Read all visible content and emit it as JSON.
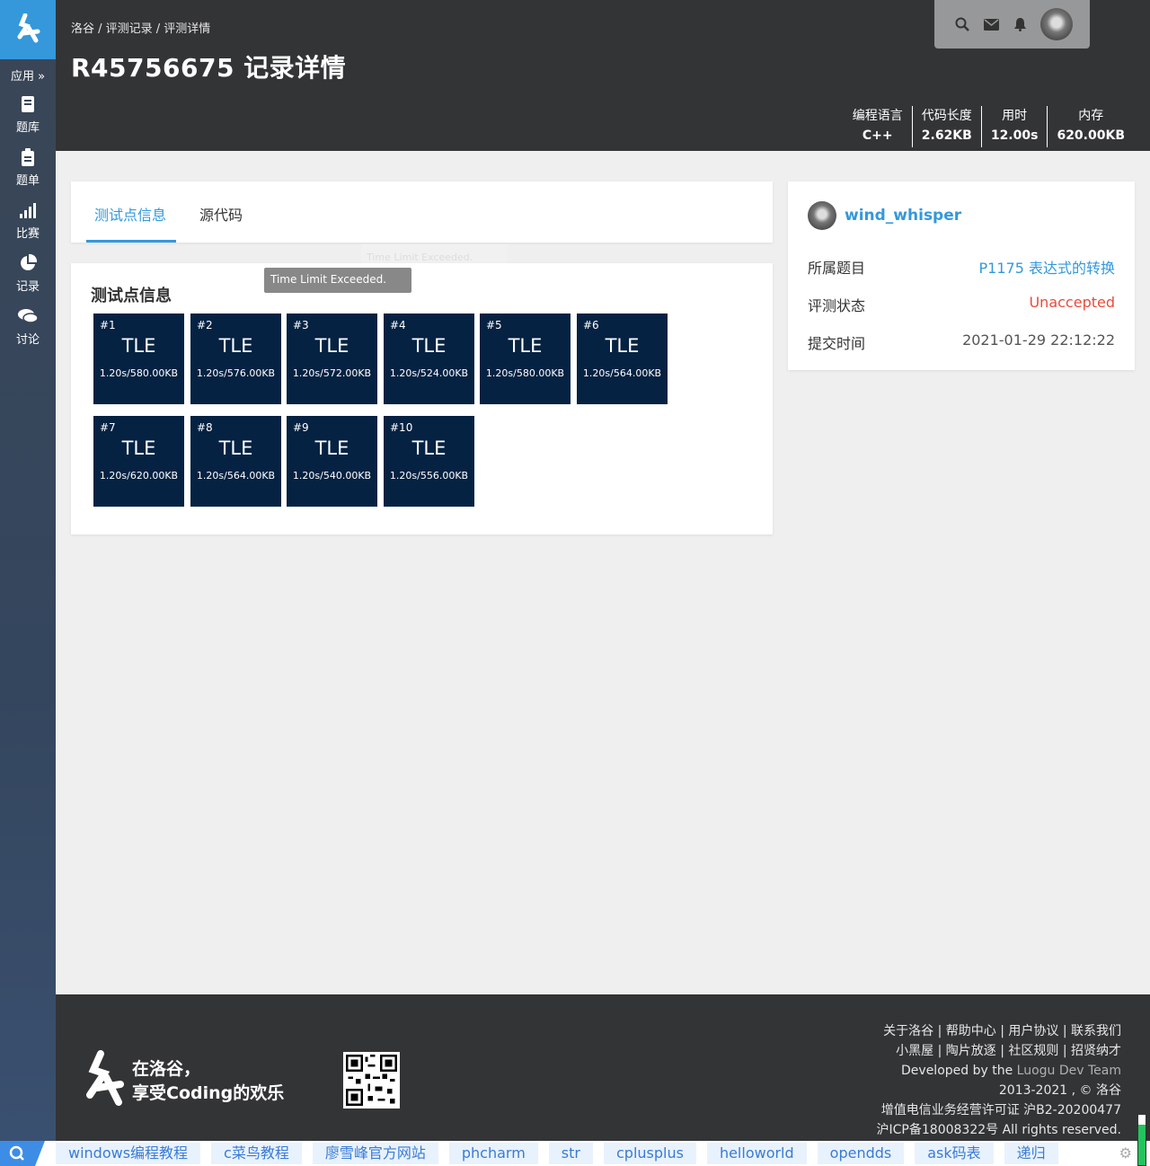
{
  "sidebar": {
    "apps_label": "应用 »",
    "items": [
      {
        "label": "题库",
        "icon": "book-icon"
      },
      {
        "label": "题单",
        "icon": "clipboard-icon"
      },
      {
        "label": "比赛",
        "icon": "bar-chart-icon"
      },
      {
        "label": "记录",
        "icon": "pie-chart-icon"
      },
      {
        "label": "讨论",
        "icon": "chat-icon"
      }
    ]
  },
  "header": {
    "breadcrumb": "洛谷 / 评测记录 / 评测详情",
    "title": "R45756675 记录详情",
    "stats": [
      {
        "key": "编程语言",
        "value": "C++"
      },
      {
        "key": "代码长度",
        "value": "2.62KB"
      },
      {
        "key": "用时",
        "value": "12.00s"
      },
      {
        "key": "内存",
        "value": "620.00KB"
      }
    ]
  },
  "tabs": [
    {
      "label": "测试点信息",
      "active": true
    },
    {
      "label": "源代码",
      "active": false
    }
  ],
  "cases": {
    "title": "测试点信息",
    "tooltip": "Time Limit Exceeded.",
    "ghost_tooltip": "Time Limit Exceeded.",
    "items": [
      {
        "num": "#1",
        "status": "TLE",
        "detail": "1.20s/580.00KB"
      },
      {
        "num": "#2",
        "status": "TLE",
        "detail": "1.20s/576.00KB"
      },
      {
        "num": "#3",
        "status": "TLE",
        "detail": "1.20s/572.00KB"
      },
      {
        "num": "#4",
        "status": "TLE",
        "detail": "1.20s/524.00KB"
      },
      {
        "num": "#5",
        "status": "TLE",
        "detail": "1.20s/580.00KB"
      },
      {
        "num": "#6",
        "status": "TLE",
        "detail": "1.20s/564.00KB"
      },
      {
        "num": "#7",
        "status": "TLE",
        "detail": "1.20s/620.00KB"
      },
      {
        "num": "#8",
        "status": "TLE",
        "detail": "1.20s/564.00KB"
      },
      {
        "num": "#9",
        "status": "TLE",
        "detail": "1.20s/540.00KB"
      },
      {
        "num": "#10",
        "status": "TLE",
        "detail": "1.20s/556.00KB"
      }
    ]
  },
  "info": {
    "username": "wind_whisper",
    "problem_label": "所属题目",
    "problem_value": "P1175 表达式的转换",
    "status_label": "评测状态",
    "status_value": "Unaccepted",
    "time_label": "提交时间",
    "time_value": "2021-01-29 22:12:22"
  },
  "footer": {
    "slogan_1": "在洛谷，",
    "slogan_2": "享受Coding的欢乐",
    "line_1": "关于洛谷 | 帮助中心 | 用户协议 | 联系我们",
    "line_2": "小黑屋 | 陶片放逐 | 社区规则 | 招贤纳才",
    "line_3a": "Developed by the ",
    "line_3b": "Luogu Dev Team",
    "line_4": "2013-2021 , © 洛谷",
    "line_5": "增值电信业务经营许可证 沪B2-20200477",
    "line_6": "沪ICP备18008322号 All rights reserved."
  },
  "bookmarks": [
    "windows编程教程",
    "c菜鸟教程",
    "廖雪峰官方网站",
    "phcharm",
    "str",
    "cplusplus",
    "helloworld",
    "opendds",
    "ask码表",
    "递归"
  ],
  "colors": {
    "accent": "#3498db",
    "tle_box": "#052242",
    "unaccepted": "#e74c3c",
    "header_bg": "#333436"
  }
}
